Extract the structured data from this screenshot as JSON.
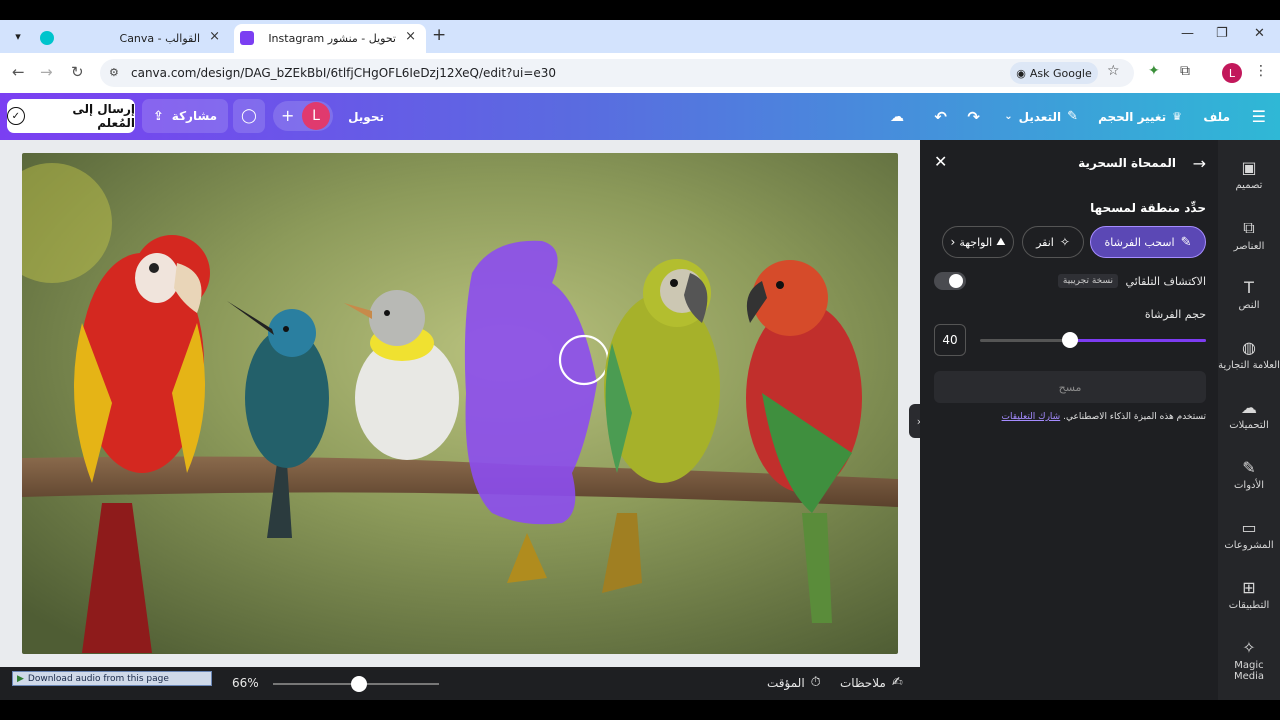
{
  "browser": {
    "tabs": [
      {
        "title": "القوالب - Canva",
        "active": false
      },
      {
        "title": "تحويل - منشور Instagram",
        "active": true
      }
    ],
    "url": "canva.com/design/DAG_bZEkBbI/6tlfjCHgOFL6IeDzj12XeQ/edit?ui=e30",
    "ask_google_label": "Ask Google",
    "profile_initial": "L"
  },
  "header": {
    "menu_label": "ملف",
    "resize_label": "تغيير الحجم",
    "edit_label": "التعديل",
    "doc_title": "تحويل",
    "avatar_initial": "L",
    "share_label": "مشاركة",
    "send_label": "إرسال إلى المُعلم"
  },
  "panel": {
    "title": "الممحاة السحرية",
    "subtitle": "حدِّد منطقة لمسحها",
    "modes": [
      {
        "label": "اسحب الفرشاة",
        "selected": true
      },
      {
        "label": "انقر",
        "selected": false
      },
      {
        "label": "الواجهة",
        "selected": false
      }
    ],
    "autodetect_label": "الاكتشاف التلقائي",
    "beta_badge": "نسخة تجريبية",
    "brush_size_label": "حجم الفرشاة",
    "brush_size_value": "40",
    "brush_fraction": 0.6,
    "erase_button": "مسح",
    "ai_notice": "تستخدم هذه الميزة الذكاء الاصطناعي.",
    "feedback_link": "شارك التعليقات"
  },
  "rail": [
    {
      "label": "تصميم",
      "icon": "layout-icon"
    },
    {
      "label": "العناصر",
      "icon": "elements-icon"
    },
    {
      "label": "النص",
      "icon": "text-icon"
    },
    {
      "label": "العلامة التجارية",
      "icon": "brand-icon"
    },
    {
      "label": "التحميلات",
      "icon": "upload-icon"
    },
    {
      "label": "الأدوات",
      "icon": "tools-icon"
    },
    {
      "label": "المشروعات",
      "icon": "folder-icon"
    },
    {
      "label": "التطبيقات",
      "icon": "apps-icon"
    },
    {
      "label": "Magic Media",
      "icon": "magic-media-icon"
    }
  ],
  "footer": {
    "zoom": "66%",
    "zoom_fraction": 0.52,
    "timer_label": "المؤقت",
    "notes_label": "ملاحظات",
    "download_audio": "Download audio from this page"
  }
}
